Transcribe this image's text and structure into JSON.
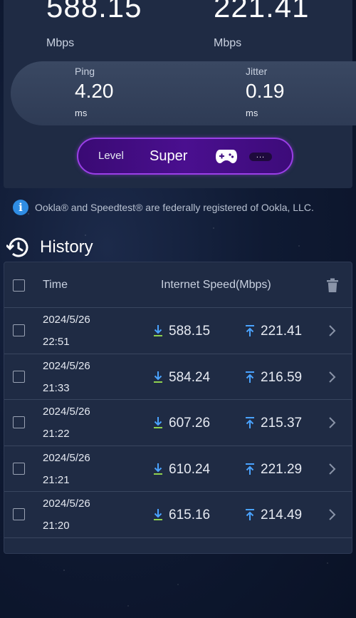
{
  "result": {
    "download_value": "588.15",
    "download_unit": "Mbps",
    "upload_value": "221.41",
    "upload_unit": "Mbps"
  },
  "metrics": {
    "ping_label": "Ping",
    "ping_value": "4.20",
    "ping_unit": "ms",
    "jitter_label": "Jitter",
    "jitter_value": "0.19",
    "jitter_unit": "ms"
  },
  "level": {
    "label": "Level",
    "value": "Super",
    "icon": "gamepad-icon",
    "more_label": "..."
  },
  "notice": {
    "text": "Ookla® and Speedtest® are federally registered of Ookla, LLC."
  },
  "history": {
    "title": "History",
    "columns": {
      "time": "Time",
      "speed": "Internet Speed(Mbps)"
    },
    "rows": [
      {
        "date": "2024/5/26",
        "time": "22:51",
        "download": "588.15",
        "upload": "221.41"
      },
      {
        "date": "2024/5/26",
        "time": "21:33",
        "download": "584.24",
        "upload": "216.59"
      },
      {
        "date": "2024/5/26",
        "time": "21:22",
        "download": "607.26",
        "upload": "215.37"
      },
      {
        "date": "2024/5/26",
        "time": "21:21",
        "download": "610.24",
        "upload": "221.29"
      },
      {
        "date": "2024/5/26",
        "time": "21:20",
        "download": "615.16",
        "upload": "214.49"
      }
    ]
  },
  "colors": {
    "download_arrow": "#8fd14f",
    "upload_arrow": "#4aa3ff",
    "level_border": "#9a3fe6",
    "info": "#2f8de4"
  }
}
